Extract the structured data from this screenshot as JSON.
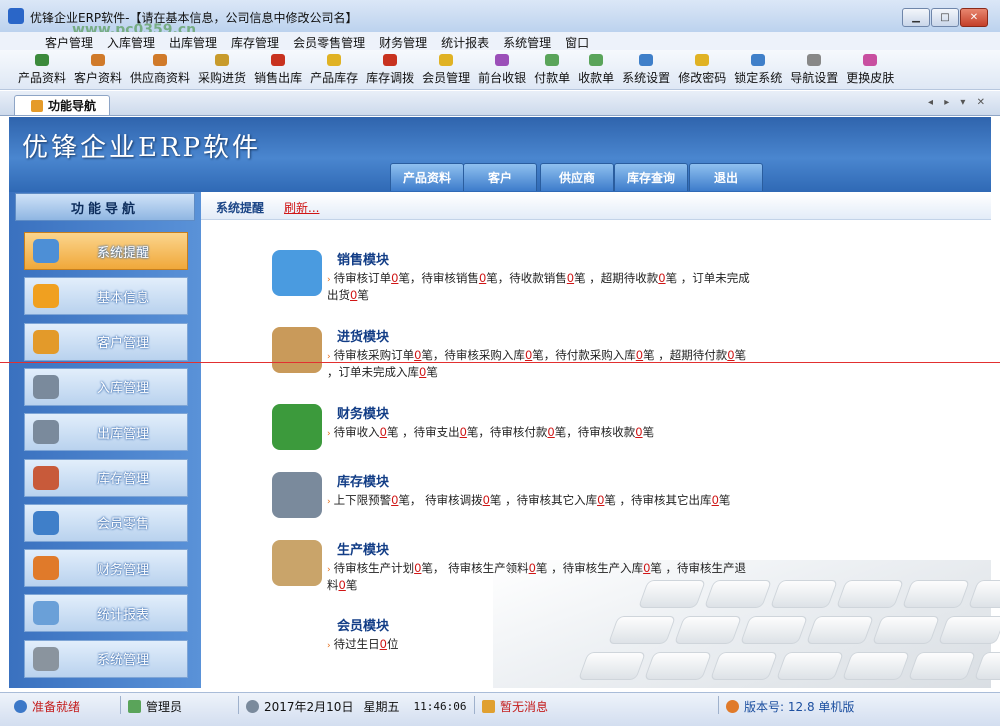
{
  "window": {
    "title": "优锋企业ERP软件-【请在基本信息，公司信息中修改公司名】",
    "watermark": "www.pc0359.cn"
  },
  "menu": [
    "客户管理",
    "入库管理",
    "出库管理",
    "库存管理",
    "会员零售管理",
    "财务管理",
    "统计报表",
    "系统管理",
    "窗口"
  ],
  "toolbar": [
    {
      "label": "产品资料",
      "icon": "product-icon",
      "color": "#3c8a3c"
    },
    {
      "label": "客户资料",
      "icon": "customer-icon",
      "color": "#d07a2a"
    },
    {
      "label": "供应商资料",
      "icon": "supplier-icon",
      "color": "#d07a2a"
    },
    {
      "label": "采购进货",
      "icon": "purchase-icon",
      "color": "#c89b2c"
    },
    {
      "label": "销售出库",
      "icon": "sales-icon",
      "color": "#c8321f"
    },
    {
      "label": "产品库存",
      "icon": "stock-icon",
      "color": "#e0b224"
    },
    {
      "label": "库存调拨",
      "icon": "transfer-icon",
      "color": "#c8321f"
    },
    {
      "label": "会员管理",
      "icon": "member-icon",
      "color": "#e0b224"
    },
    {
      "label": "前台收银",
      "icon": "cashier-icon",
      "color": "#9b4fb8"
    },
    {
      "label": "付款单",
      "icon": "payment-icon",
      "color": "#5aa45a"
    },
    {
      "label": "收款单",
      "icon": "receipt-icon",
      "color": "#5aa45a"
    },
    {
      "label": "系统设置",
      "icon": "settings-icon",
      "color": "#3f7fc9"
    },
    {
      "label": "修改密码",
      "icon": "password-icon",
      "color": "#e0b224"
    },
    {
      "label": "锁定系统",
      "icon": "lock-icon",
      "color": "#3f7fc9"
    },
    {
      "label": "导航设置",
      "icon": "nav-settings-icon",
      "color": "#888888"
    },
    {
      "label": "更换皮肤",
      "icon": "skin-icon",
      "color": "#c84fa0"
    }
  ],
  "tab": {
    "label": "功能导航"
  },
  "banner": {
    "title": "优锋企业ERP软件",
    "buttons": [
      "产品资料",
      "客户",
      "供应商",
      "库存查询",
      "退出"
    ]
  },
  "nav": {
    "header": "功能导航",
    "items": [
      {
        "label": "系统提醒",
        "active": true,
        "color": "#4d8fd6"
      },
      {
        "label": "基本信息",
        "active": false,
        "color": "#f0a020"
      },
      {
        "label": "客户管理",
        "active": false,
        "color": "#e39a2a"
      },
      {
        "label": "入库管理",
        "active": false,
        "color": "#7a8a9c"
      },
      {
        "label": "出库管理",
        "active": false,
        "color": "#7a8a9c"
      },
      {
        "label": "库存管理",
        "active": false,
        "color": "#c85a3a"
      },
      {
        "label": "会员零售",
        "active": false,
        "color": "#3f7fc9"
      },
      {
        "label": "财务管理",
        "active": false,
        "color": "#e07a2a"
      },
      {
        "label": "统计报表",
        "active": false,
        "color": "#6aa0d8"
      },
      {
        "label": "系统管理",
        "active": false,
        "color": "#8a949e"
      }
    ]
  },
  "content": {
    "section_label": "系统提醒",
    "refresh": "刷新...",
    "modules": [
      {
        "title": "销售模块",
        "icon": "book-icon",
        "color": "#4a9be0",
        "segments": [
          "待审核订单",
          "0",
          "笔，待审核销售",
          "0",
          "笔，待收款销售",
          "0",
          "笔 ，超期待收款",
          "0",
          "笔 ，订单未完成出货",
          "0",
          "笔"
        ]
      },
      {
        "title": "进货模块",
        "icon": "package-icon",
        "color": "#c99a5a",
        "segments": [
          "待审核采购订单",
          "0",
          "笔，待审核采购入库",
          "0",
          "笔，待付款采购入库",
          "0",
          "笔 ，超期待付款",
          "0",
          "笔 ，订单未完成入库",
          "0",
          "笔"
        ]
      },
      {
        "title": "财务模块",
        "icon": "dollar-icon",
        "color": "#3c9a3c",
        "segments": [
          "待审收入",
          "0",
          "笔 ，待审支出",
          "0",
          "笔，待审核付款",
          "0",
          "笔，待审核收款",
          "0",
          "笔"
        ]
      },
      {
        "title": "库存模块",
        "icon": "database-icon",
        "color": "#7a8a9c",
        "segments": [
          "上下限预警",
          "0",
          "笔， 待审核调拨",
          "0",
          "笔 ，待审核其它入库",
          "0",
          "笔 ，待审核其它出库",
          "0",
          "笔"
        ]
      },
      {
        "title": "生产模块",
        "icon": "clipboard-icon",
        "color": "#c9a46a",
        "segments": [
          "待审核生产计划",
          "0",
          "笔， 待审核生产领料",
          "0",
          "笔 ，待审核生产入库",
          "0",
          "笔 ，待审核生产退料",
          "0",
          "笔"
        ]
      },
      {
        "title": "会员模块",
        "icon": "",
        "color": "",
        "segments": [
          "待过生日",
          "0",
          "位"
        ]
      }
    ]
  },
  "status": {
    "ready": "准备就绪",
    "user": "管理员",
    "date": "2017年2月10日",
    "weekday": "星期五",
    "time": "11:46:06",
    "message": "暂无消息",
    "version": "版本号: 12.8 单机版"
  }
}
